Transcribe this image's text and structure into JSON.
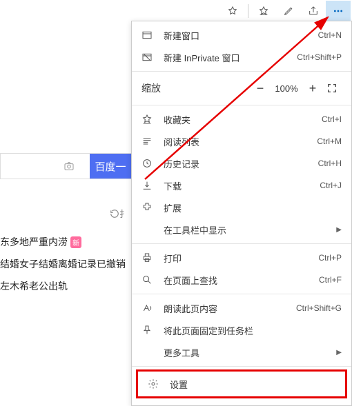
{
  "toolbar": {
    "star_outline": "☆",
    "favorites": "⭐",
    "notes": "✎",
    "share": "↗",
    "more": "⋯"
  },
  "search": {
    "button_label": "百度一"
  },
  "refresh": {
    "label": "扌"
  },
  "news": [
    {
      "text": "东多地严重内涝",
      "badge": "新"
    },
    {
      "text": "结婚女子结婚离婚记录已撤销",
      "badge": ""
    },
    {
      "text": "左木希老公出轨",
      "badge": ""
    }
  ],
  "menu": {
    "new_window": {
      "label": "新建窗口",
      "shortcut": "Ctrl+N"
    },
    "new_inprivate": {
      "label": "新建 InPrivate 窗口",
      "shortcut": "Ctrl+Shift+P"
    },
    "zoom": {
      "label": "缩放",
      "value": "100%"
    },
    "favorites": {
      "label": "收藏夹",
      "shortcut": "Ctrl+I"
    },
    "reading_list": {
      "label": "阅读列表",
      "shortcut": "Ctrl+M"
    },
    "history": {
      "label": "历史记录",
      "shortcut": "Ctrl+H"
    },
    "downloads": {
      "label": "下载",
      "shortcut": "Ctrl+J"
    },
    "extensions": {
      "label": "扩展",
      "shortcut": ""
    },
    "show_in_toolbar": {
      "label": "在工具栏中显示",
      "shortcut": ""
    },
    "print": {
      "label": "打印",
      "shortcut": "Ctrl+P"
    },
    "find": {
      "label": "在页面上查找",
      "shortcut": "Ctrl+F"
    },
    "read_aloud": {
      "label": "朗读此页内容",
      "shortcut": "Ctrl+Shift+G"
    },
    "pin_taskbar": {
      "label": "将此页面固定到任务栏",
      "shortcut": ""
    },
    "more_tools": {
      "label": "更多工具",
      "shortcut": ""
    },
    "settings": {
      "label": "设置",
      "shortcut": ""
    }
  }
}
